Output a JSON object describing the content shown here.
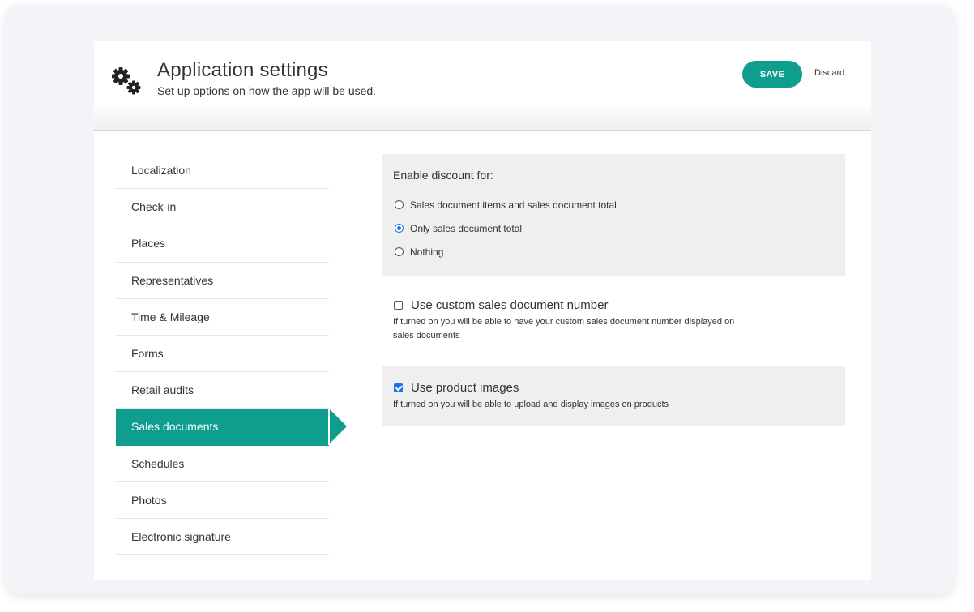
{
  "header": {
    "title": "Application settings",
    "subtitle": "Set up options on how the app will be used.",
    "icon": "gears-icon",
    "save_label": "SAVE",
    "discard_label": "Discard"
  },
  "sidebar": {
    "active_index": 7,
    "items": [
      {
        "label": "Localization"
      },
      {
        "label": "Check-in"
      },
      {
        "label": "Places"
      },
      {
        "label": "Representatives"
      },
      {
        "label": "Time & Mileage"
      },
      {
        "label": "Forms"
      },
      {
        "label": "Retail audits"
      },
      {
        "label": "Sales documents"
      },
      {
        "label": "Schedules"
      },
      {
        "label": "Photos"
      },
      {
        "label": "Electronic signature"
      }
    ]
  },
  "discount": {
    "heading": "Enable discount for:",
    "selected_index": 1,
    "options": [
      {
        "label": "Sales document items and sales document total"
      },
      {
        "label": "Only sales document total"
      },
      {
        "label": "Nothing"
      }
    ]
  },
  "custom_number": {
    "label": "Use custom sales document number",
    "checked": false,
    "help": "If turned on you will be able to have your custom sales document number displayed on sales documents"
  },
  "product_images": {
    "label": "Use product images",
    "checked": true,
    "help": "If turned on you will be able to upload and display images on products"
  },
  "colors": {
    "accent": "#0f9d8d",
    "checkbox_blue": "#1a73e8",
    "panel_bg": "#efefef"
  }
}
